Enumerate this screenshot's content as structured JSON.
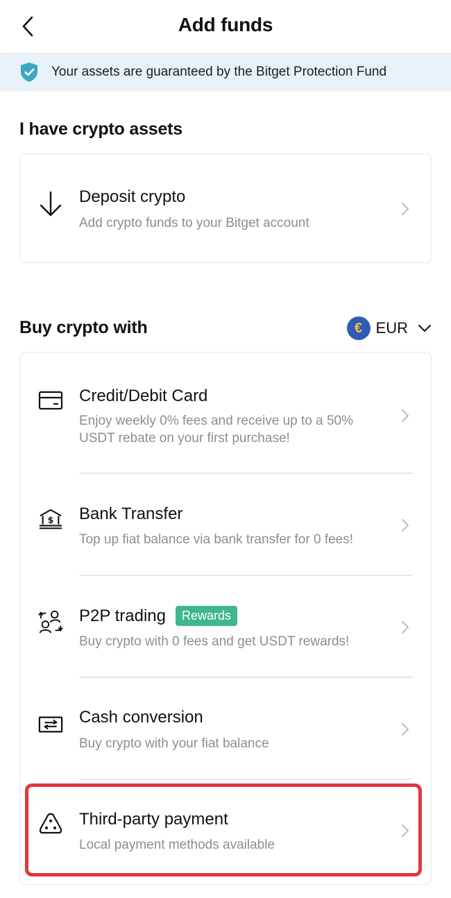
{
  "header": {
    "title": "Add funds"
  },
  "banner": {
    "text": "Your assets are guaranteed by the Bitget Protection Fund"
  },
  "crypto_section": {
    "title": "I have crypto assets",
    "items": [
      {
        "title": "Deposit crypto",
        "description": "Add crypto funds to your Bitget account",
        "icon": "arrow-down-icon"
      }
    ]
  },
  "buy_section": {
    "title": "Buy crypto with",
    "currency": {
      "symbol": "€",
      "label": "EUR"
    },
    "items": [
      {
        "title": "Credit/Debit Card",
        "description": "Enjoy weekly 0% fees and receive up to a 50% USDT rebate on your first purchase!",
        "icon": "credit-card-icon"
      },
      {
        "title": "Bank Transfer",
        "description": "Top up fiat balance via bank transfer for 0 fees!",
        "icon": "bank-icon"
      },
      {
        "title": "P2P trading",
        "badge": "Rewards",
        "description": "Buy crypto with 0 fees and get USDT rewards!",
        "icon": "p2p-icon"
      },
      {
        "title": "Cash conversion",
        "description": "Buy crypto with your fiat balance",
        "icon": "cash-conversion-icon"
      },
      {
        "title": "Third-party payment",
        "description": "Local payment methods available",
        "icon": "third-party-icon"
      }
    ]
  },
  "colors": {
    "banner_bg": "#e9f1f8",
    "shield": "#3aa8c4",
    "badge": "#3fb68b",
    "highlight": "#e0383d",
    "euro_coin": "#2f5cb5"
  }
}
